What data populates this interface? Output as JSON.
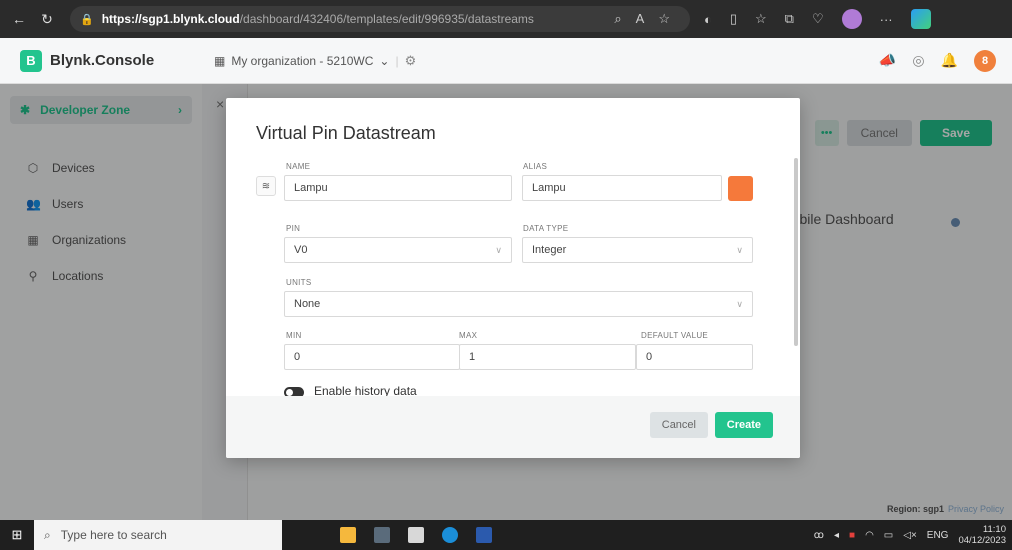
{
  "browser": {
    "url_host": "https://sgp1.blynk.cloud",
    "url_path": "/dashboard/432406/templates/edit/996935/datastreams"
  },
  "header": {
    "logo_letter": "B",
    "app_name": "Blynk.Console",
    "org": "My organization - 5210WC",
    "avatar_letter": "8"
  },
  "sidebar": {
    "dev_zone": "Developer Zone",
    "items": [
      {
        "label": "Devices",
        "icon": "devices-icon"
      },
      {
        "label": "Users",
        "icon": "users-icon"
      },
      {
        "label": "Organizations",
        "icon": "organizations-icon"
      },
      {
        "label": "Locations",
        "icon": "locations-icon"
      }
    ]
  },
  "main": {
    "more": "•••",
    "cancel": "Cancel",
    "save": "Save",
    "mobile_dashboard": "Mobile Dashboard",
    "region_label": "Region: sgp1",
    "privacy": "Privacy Policy"
  },
  "modal": {
    "title": "Virtual Pin Datastream",
    "name_label": "NAME",
    "name_value": "Lampu",
    "alias_label": "ALIAS",
    "alias_value": "Lampu",
    "color": "#f5793b",
    "pin_label": "PIN",
    "pin_value": "V0",
    "data_type_label": "DATA TYPE",
    "data_type_value": "Integer",
    "units_label": "UNITS",
    "units_value": "None",
    "min_label": "MIN",
    "min_value": "0",
    "max_label": "MAX",
    "max_value": "1",
    "default_label": "DEFAULT VALUE",
    "default_value": "0",
    "history_label": "Enable history data",
    "cancel": "Cancel",
    "create": "Create"
  },
  "taskbar": {
    "search_placeholder": "Type here to search",
    "lang": "ENG",
    "time": "11:10",
    "date": "04/12/2023"
  }
}
